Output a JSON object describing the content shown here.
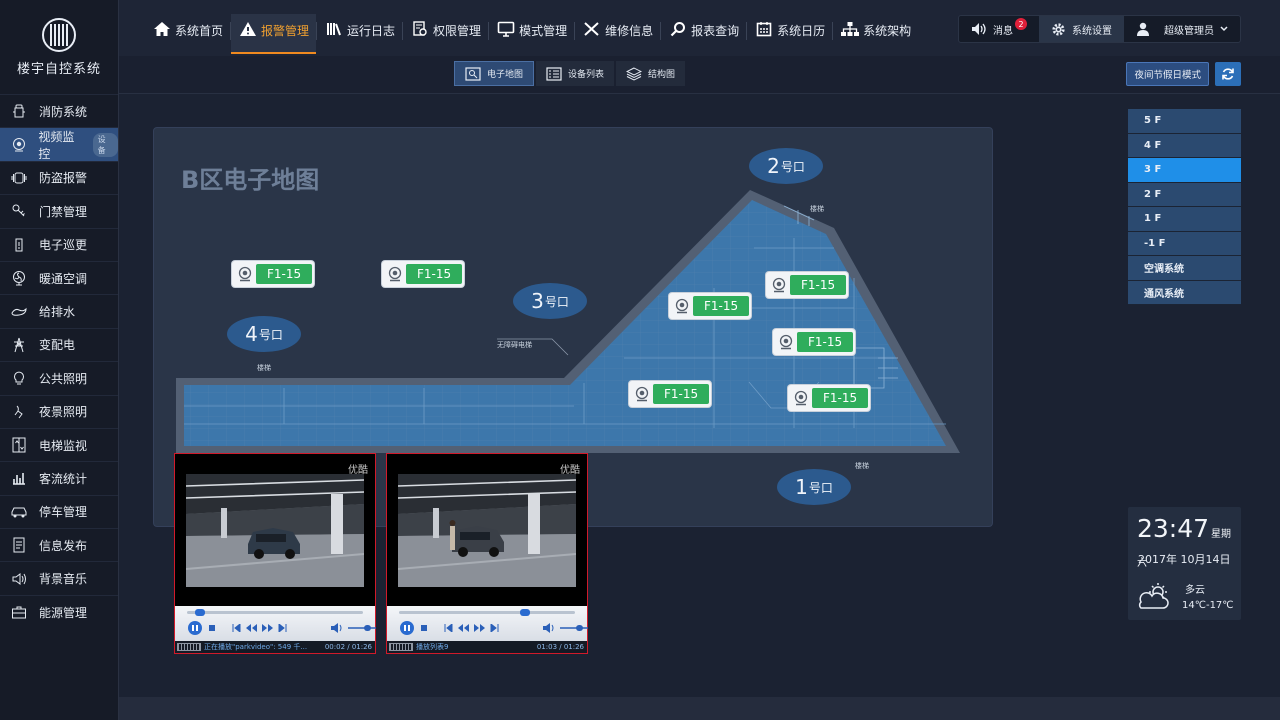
{
  "app": {
    "title": "楼宇自控系统"
  },
  "sidebar": {
    "items": [
      {
        "label": "消防系统",
        "icon": "fire-hydrant-icon"
      },
      {
        "label": "视频监控",
        "icon": "camera-icon",
        "tag": "设备",
        "active": true
      },
      {
        "label": "防盗报警",
        "icon": "alarm-icon"
      },
      {
        "label": "门禁管理",
        "icon": "key-icon"
      },
      {
        "label": "电子巡更",
        "icon": "patrol-icon"
      },
      {
        "label": "暖通空调",
        "icon": "fan-icon"
      },
      {
        "label": "给排水",
        "icon": "water-icon"
      },
      {
        "label": "变配电",
        "icon": "tower-icon"
      },
      {
        "label": "公共照明",
        "icon": "bulb-icon"
      },
      {
        "label": "夜景照明",
        "icon": "night-icon"
      },
      {
        "label": "电梯监视",
        "icon": "elevator-icon"
      },
      {
        "label": "客流统计",
        "icon": "chart-icon"
      },
      {
        "label": "停车管理",
        "icon": "car-icon"
      },
      {
        "label": "信息发布",
        "icon": "document-icon"
      },
      {
        "label": "背景音乐",
        "icon": "speaker-icon"
      },
      {
        "label": "能源管理",
        "icon": "briefcase-icon"
      }
    ]
  },
  "topnav": {
    "items": [
      {
        "label": "系统首页",
        "icon": "home-icon"
      },
      {
        "label": "报警管理",
        "icon": "warning-icon",
        "active": true
      },
      {
        "label": "运行日志",
        "icon": "log-icon"
      },
      {
        "label": "权限管理",
        "icon": "permission-icon"
      },
      {
        "label": "模式管理",
        "icon": "monitor-icon"
      },
      {
        "label": "维修信息",
        "icon": "tools-icon"
      },
      {
        "label": "报表查询",
        "icon": "search-icon"
      },
      {
        "label": "系统日历",
        "icon": "calendar-icon"
      },
      {
        "label": "系统架构",
        "icon": "sitemap-icon"
      }
    ]
  },
  "topright": {
    "messages_label": "消息",
    "messages_count": "2",
    "settings_label": "系统设置",
    "user_label": "超级管理员"
  },
  "subtabs": [
    {
      "label": "电子地图",
      "icon": "map-icon",
      "active": true
    },
    {
      "label": "设备列表",
      "icon": "list-icon"
    },
    {
      "label": "结构图",
      "icon": "layers-icon"
    }
  ],
  "holiday_button": "夜间节假日模式",
  "map": {
    "title": "B区电子地图",
    "gates": [
      {
        "num": "2",
        "suffix": "号口"
      },
      {
        "num": "3",
        "suffix": "号口"
      },
      {
        "num": "4",
        "suffix": "号口"
      },
      {
        "num": "1",
        "suffix": "号口"
      }
    ],
    "labels": {
      "stairs1": "楼梯",
      "stairs2": "楼梯",
      "stairs3": "楼梯",
      "elevator": "无障碍电梯"
    },
    "cameras": [
      "F1-15",
      "F1-15",
      "F1-15",
      "F1-15",
      "F1-15",
      "F1-15",
      "F1-15"
    ]
  },
  "players": [
    {
      "watermark": "优酷",
      "status": "正在播放\"parkvideo\": 549 千...",
      "time": "00:02 / 01:26",
      "progress": 0.05
    },
    {
      "watermark": "优酷",
      "status": "播放列表9",
      "time": "01:03 / 01:26",
      "progress": 0.73
    }
  ],
  "floors": [
    "5 F",
    "4 F",
    "3 F",
    "2 F",
    "1 F",
    "-1 F",
    "空调系统",
    "通风系统"
  ],
  "active_floor": "3 F",
  "clock": {
    "time": "23:47",
    "weekday": "星期六",
    "date": "2017年 10月14日",
    "weather": "多云",
    "temp": "14℃-17℃"
  },
  "colors": {
    "accent": "#f08a20",
    "active_blue": "#1f8fe8",
    "camera_green": "#2fad5c",
    "player_border": "#d11a2a"
  }
}
